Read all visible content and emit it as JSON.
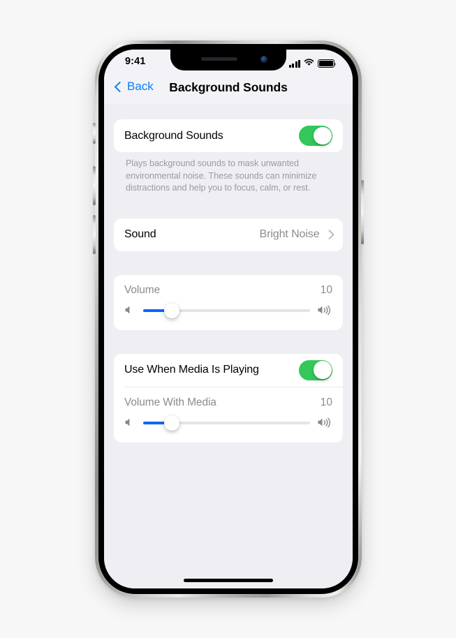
{
  "status_bar": {
    "time": "9:41",
    "cellular_icon": "signal-bars-icon",
    "wifi_icon": "wifi-icon",
    "battery_icon": "battery-full-icon"
  },
  "nav": {
    "back_label": "Back",
    "back_icon": "chevron-left-icon",
    "title": "Background Sounds"
  },
  "sections": {
    "main_toggle": {
      "label": "Background Sounds",
      "enabled": true,
      "description": "Plays background sounds to mask unwanted environmental noise. These sounds can minimize distractions and help you to focus, calm, or rest."
    },
    "sound": {
      "label": "Sound",
      "value": "Bright Noise",
      "disclosure_icon": "chevron-right-icon"
    },
    "volume": {
      "label": "Volume",
      "value": "10",
      "percent": 17,
      "min_icon": "speaker-low-icon",
      "max_icon": "speaker-high-icon"
    },
    "media": {
      "toggle_label": "Use When Media Is Playing",
      "enabled": true,
      "volume_label": "Volume With Media",
      "volume_value": "10",
      "volume_percent": 17,
      "min_icon": "speaker-low-icon",
      "max_icon": "speaker-high-icon"
    }
  },
  "home_indicator": "home-indicator",
  "colors": {
    "accent_blue": "#0a7cff",
    "slider_blue": "#0a66ff",
    "toggle_green": "#34c759",
    "screen_bg": "#eeeef3",
    "card_bg": "#ffffff"
  }
}
